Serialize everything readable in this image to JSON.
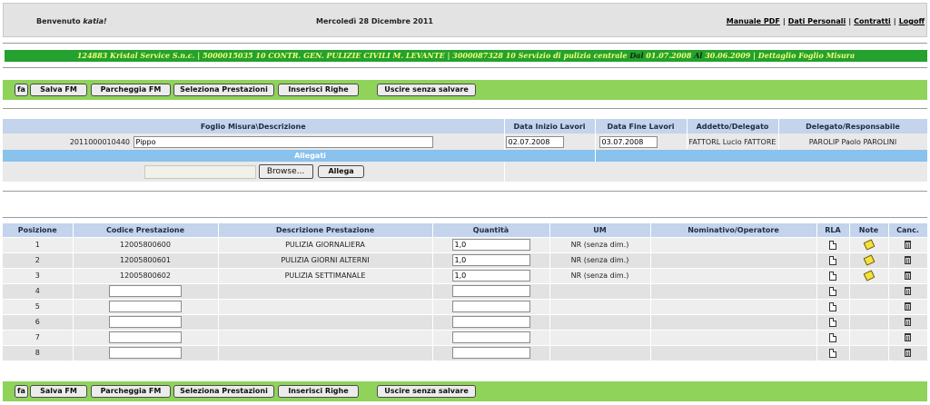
{
  "header": {
    "welcome_prefix": "Benvenuto ",
    "username": "katia!",
    "date": "Mercoledì 28 Dicembre 2011",
    "links": [
      {
        "label": "Manuale PDF"
      },
      {
        "label": "Dati Personali"
      },
      {
        "label": "Contratti"
      },
      {
        "label": "Logoff"
      }
    ]
  },
  "breadcrumb": {
    "part1": "124883 Kristal Service S.n.c. | 5000015035 10 CONTR. GEN. PULIZIE CIVILI M. LEVANTE | 3000087328 10 Servizio di pulizia centrale ",
    "dal_label": "Dal",
    "date_from": " 01.07.2008 ",
    "al_label": "Al",
    "date_to": " 30.06.2009 | Dettaglio Foglio Misura"
  },
  "toolbar": {
    "small_label": "fa",
    "salva": "Salva FM",
    "parcheggia": "Parcheggia FM",
    "seleziona": "Seleziona Prestazioni",
    "inserisci": "Inserisci Righe",
    "uscire": "Uscire senza salvare"
  },
  "foglio": {
    "headers": {
      "descrizione": "Foglio Misura\\Descrizione",
      "data_inizio": "Data Inizio Lavori",
      "data_fine": "Data Fine Lavori",
      "addetto": "Addetto/Delegato",
      "delegato": "Delegato/Responsabile"
    },
    "numero": "2011000010440",
    "descrizione_value": "Pippo",
    "data_inizio_value": "02.07.2008",
    "data_fine_value": "03.07.2008",
    "addetto_value": "FATTORL Lucio FATTORE",
    "delegato_value": "PAROLIP Paolo PAROLINI",
    "allegati_label": "Allegati",
    "browse_label": "Browse...",
    "allega_label": "Allega"
  },
  "prestazioni": {
    "headers": {
      "posizione": "Posizione",
      "codice": "Codice Prestazione",
      "descrizione": "Descrizione Prestazione",
      "quantita": "Quantità",
      "um": "UM",
      "nominativo": "Nominativo/Operatore",
      "rla": "RLA",
      "note": "Note",
      "canc": "Canc."
    },
    "rows": [
      {
        "pos": "1",
        "codice": "12005800600",
        "descrizione": "PULIZIA GIORNALIERA",
        "quantita": "1,0",
        "um": "NR (senza dim.)",
        "note": true
      },
      {
        "pos": "2",
        "codice": "12005800601",
        "descrizione": "PULIZIA GIORNI ALTERNI",
        "quantita": "1,0",
        "um": "NR (senza dim.)",
        "note": true
      },
      {
        "pos": "3",
        "codice": "12005800602",
        "descrizione": "PULIZIA SETTIMANALE",
        "quantita": "1,0",
        "um": "NR (senza dim.)",
        "note": true
      },
      {
        "pos": "4",
        "codice": "",
        "descrizione": "",
        "quantita": "",
        "um": "",
        "note": false
      },
      {
        "pos": "5",
        "codice": "",
        "descrizione": "",
        "quantita": "",
        "um": "",
        "note": false
      },
      {
        "pos": "6",
        "codice": "",
        "descrizione": "",
        "quantita": "",
        "um": "",
        "note": false
      },
      {
        "pos": "7",
        "codice": "",
        "descrizione": "",
        "quantita": "",
        "um": "",
        "note": false
      },
      {
        "pos": "8",
        "codice": "",
        "descrizione": "",
        "quantita": "",
        "um": "",
        "note": false
      }
    ]
  },
  "colors": {
    "green_bar": "#24a12e",
    "toolbar_green": "#8fd35a",
    "header_blue": "#c3d4ec",
    "allegati_blue": "#89c2ec"
  }
}
